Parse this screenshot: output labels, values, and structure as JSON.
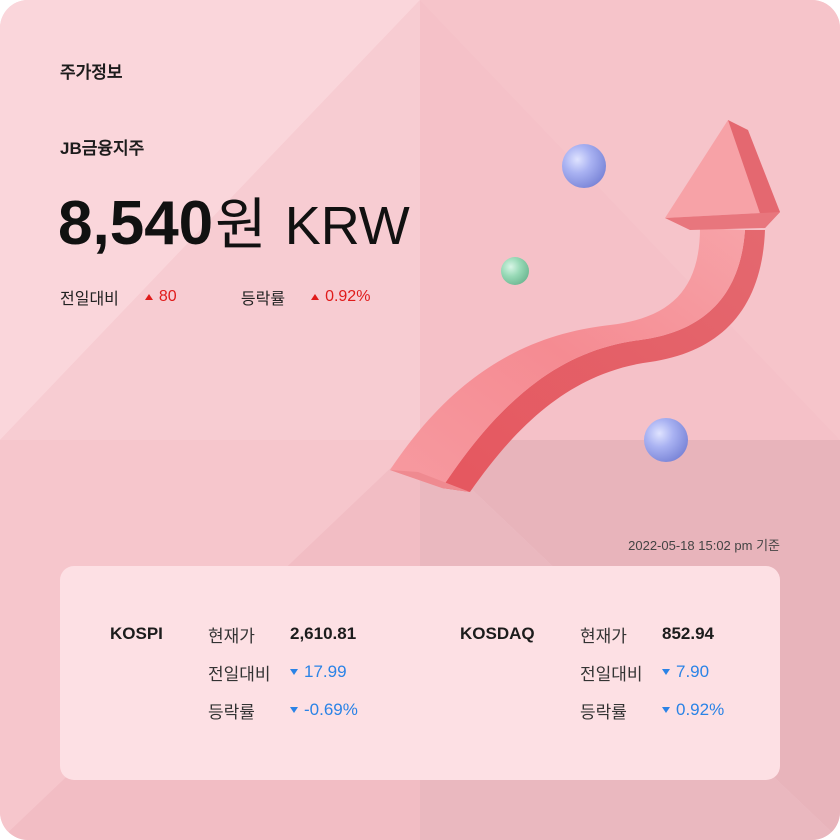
{
  "section_title": "주가정보",
  "company_name": "JB금융지주",
  "price": {
    "value": "8,540",
    "unit": "원",
    "currency": "KRW"
  },
  "change": {
    "label": "전일대비",
    "value": "80",
    "direction": "up",
    "rate_label": "등락률",
    "rate_value": "0.92%"
  },
  "timestamp": "2022-05-18 15:02 pm 기준",
  "indices": [
    {
      "name": "KOSPI",
      "rows": [
        {
          "label": "현재가",
          "value": "2,610.81",
          "direction": "none"
        },
        {
          "label": "전일대비",
          "value": "17.99",
          "direction": "down"
        },
        {
          "label": "등락률",
          "value": "-0.69%",
          "direction": "down"
        }
      ]
    },
    {
      "name": "KOSDAQ",
      "rows": [
        {
          "label": "현재가",
          "value": "852.94",
          "direction": "none"
        },
        {
          "label": "전일대비",
          "value": "7.90",
          "direction": "down"
        },
        {
          "label": "등락률",
          "value": "0.92%",
          "direction": "down"
        }
      ]
    }
  ],
  "colors": {
    "up": "#e01b1b",
    "down": "#2a83e6",
    "background": "#f7c9cf",
    "panel": "#fde0e4"
  },
  "icons": [
    "up-triangle-icon",
    "down-triangle-icon",
    "rising-arrow-illustration",
    "sphere-decoration"
  ]
}
